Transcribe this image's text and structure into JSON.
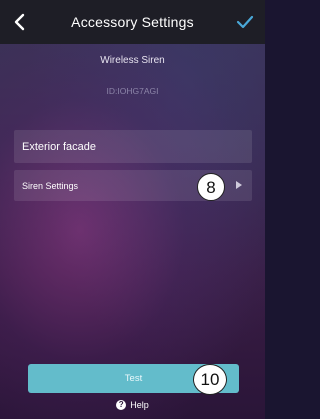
{
  "header": {
    "title": "Accessory Settings",
    "back_icon": "chevron-left-icon",
    "confirm_icon": "checkmark-icon",
    "confirm_color": "#4aa8d8"
  },
  "device": {
    "name": "Wireless Siren",
    "id": "ID:IOHG7AGI"
  },
  "settings": {
    "accessory_name": "Exterior facade",
    "siren_settings_label": "Siren Settings"
  },
  "callouts": {
    "siren_settings": "8",
    "test": "10"
  },
  "actions": {
    "test_label": "Test",
    "test_color": "#63bccb",
    "help_label": "Help"
  }
}
